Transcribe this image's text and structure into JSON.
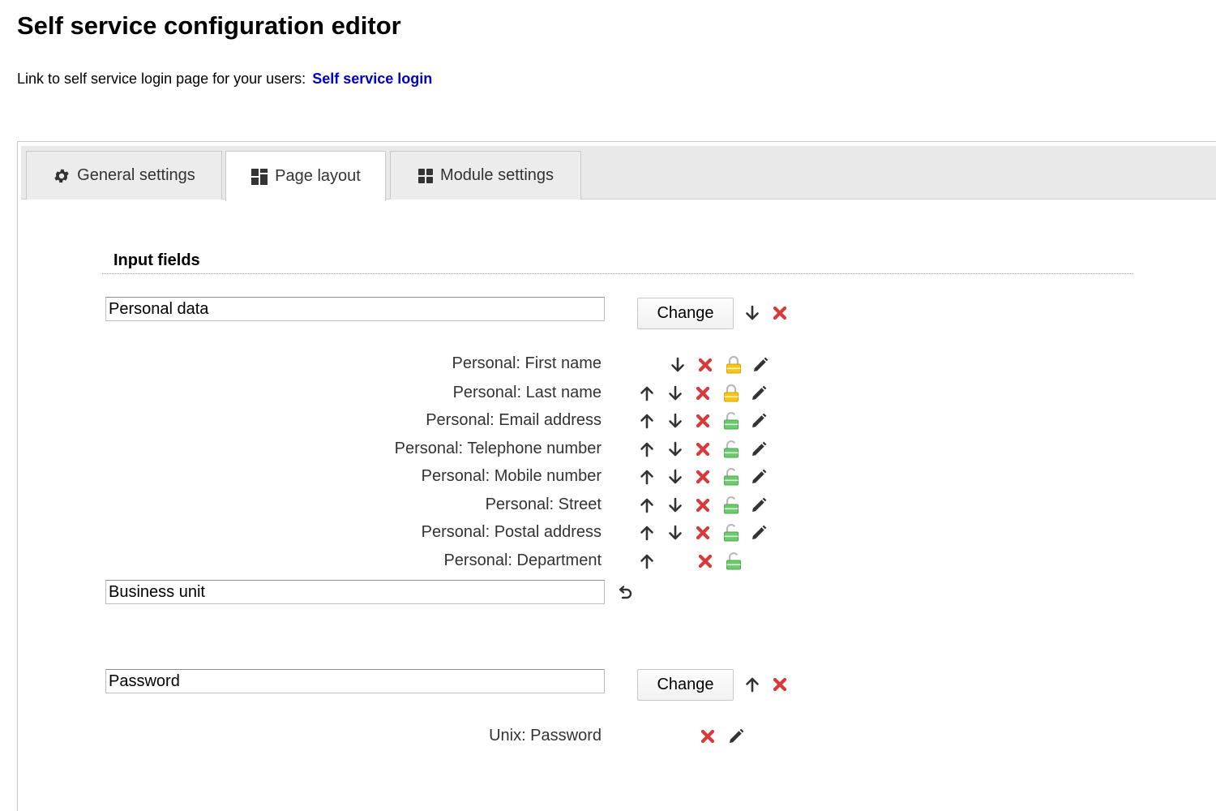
{
  "page": {
    "title": "Self service configuration editor",
    "link_prefix": "Link to self service login page for your users:",
    "link_text": "Self service login"
  },
  "tabs": [
    {
      "label": "General settings",
      "icon": "gear-icon"
    },
    {
      "label": "Page layout",
      "icon": "layout-icon",
      "active": true
    },
    {
      "label": "Module settings",
      "icon": "modules-icon"
    }
  ],
  "input_fields": {
    "heading": "Input fields",
    "groups": [
      {
        "name": "Personal data",
        "button": "Change",
        "fields": [
          {
            "label": "Personal: First name",
            "lock": "yellow"
          },
          {
            "label": "Personal: Last name",
            "lock": "yellow"
          },
          {
            "label": "Personal: Email address",
            "lock": "green"
          },
          {
            "label": "Personal: Telephone number",
            "lock": "green"
          },
          {
            "label": "Personal: Mobile number",
            "lock": "green"
          },
          {
            "label": "Personal: Street",
            "lock": "green"
          },
          {
            "label": "Personal: Postal address",
            "lock": "green"
          },
          {
            "label": "Personal: Department",
            "lock": "green"
          }
        ]
      },
      {
        "name": "Business unit"
      },
      {
        "name": "Password",
        "button": "Change",
        "fields": [
          {
            "label": "Unix: Password"
          }
        ]
      }
    ]
  },
  "colors": {
    "link": "#0000cc",
    "delete": "#d63a3a",
    "lock_yellow": "#f5c518",
    "lock_green": "#6cc96c",
    "icon_dark": "#333333"
  }
}
